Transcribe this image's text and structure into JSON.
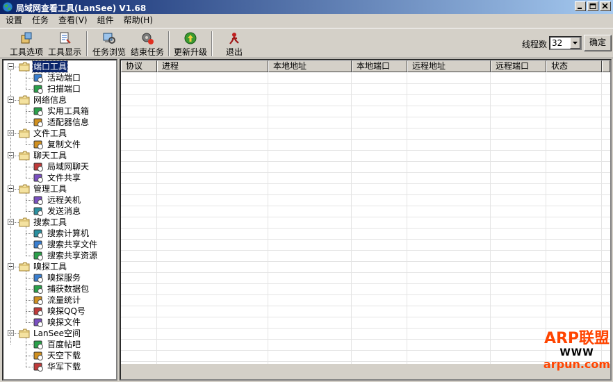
{
  "window": {
    "title": "局域网查看工具(LanSee) V1.68",
    "colors": {
      "title_start": "#0a246a",
      "title_end": "#a6caf0",
      "face": "#d4d0c8"
    }
  },
  "menu": [
    "设置",
    "任务",
    "查看(V)",
    "组件",
    "帮助(H)"
  ],
  "toolbar": {
    "buttons": [
      {
        "label": "工具选项",
        "icon": "tool-options-icon"
      },
      {
        "label": "工具显示",
        "icon": "tool-display-icon"
      },
      {
        "label": "任务浏览",
        "icon": "task-browse-icon"
      },
      {
        "label": "结束任务",
        "icon": "end-task-icon"
      },
      {
        "label": "更新升级",
        "icon": "update-icon"
      },
      {
        "label": "退出",
        "icon": "exit-icon"
      }
    ],
    "thread_label": "线程数",
    "thread_value": "32",
    "confirm_label": "确定"
  },
  "tree": [
    {
      "label": "端口工具",
      "selected": true,
      "children": [
        "活动端口",
        "扫描端口"
      ]
    },
    {
      "label": "网络信息",
      "children": [
        "实用工具箱",
        "适配器信息"
      ]
    },
    {
      "label": "文件工具",
      "children": [
        "复制文件"
      ]
    },
    {
      "label": "聊天工具",
      "children": [
        "局域网聊天",
        "文件共享"
      ]
    },
    {
      "label": "管理工具",
      "children": [
        "远程关机",
        "发送消息"
      ]
    },
    {
      "label": "搜索工具",
      "children": [
        "搜索计算机",
        "搜索共享文件",
        "搜索共享资源"
      ]
    },
    {
      "label": "嗅探工具",
      "children": [
        "嗅探服务",
        "捕获数据包",
        "流量统计",
        "嗅探QQ号",
        "嗅探文件"
      ]
    },
    {
      "label": "LanSee空间",
      "children": [
        "百度帖吧",
        "天空下载",
        "华军下载"
      ]
    }
  ],
  "list": {
    "columns": [
      "协议",
      "进程",
      "本地地址",
      "本地端口",
      "远程地址",
      "远程端口",
      "状态"
    ]
  },
  "watermark": {
    "title": "ARP联盟",
    "www": "WWW",
    "domain": "arpun.com"
  }
}
